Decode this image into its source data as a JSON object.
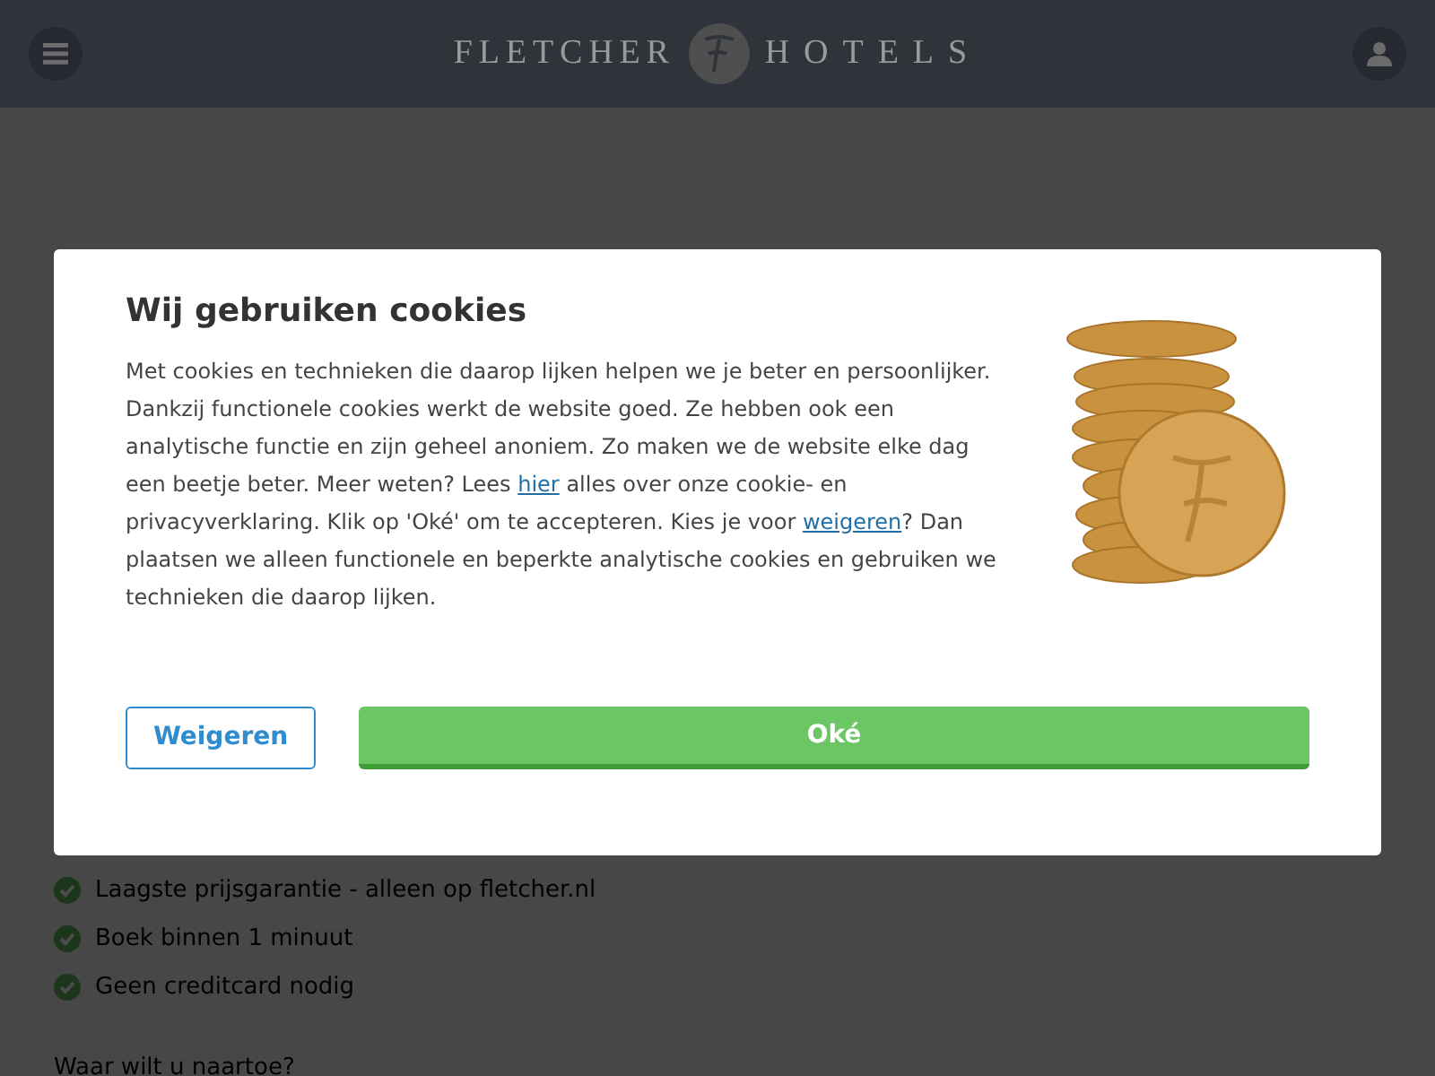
{
  "header": {
    "logo_left": "FLETCHER",
    "logo_right": "HOTELS"
  },
  "background": {
    "benefits": [
      "Laagste prijsgarantie - alleen op fletcher.nl",
      "Boek binnen 1 minuut",
      "Geen creditcard nodig"
    ],
    "question": "Waar wilt u naartoe?"
  },
  "cookie_dialog": {
    "title": "Wij gebruiken cookies",
    "body": [
      {
        "kind": "text",
        "text": "Met cookies en technieken die daarop lijken helpen we je beter en persoonlijker. Dankzij functionele cookies werkt de website goed. Ze hebben ook een analytische functie en zijn geheel anoniem. Zo maken we de website elke dag een beetje beter. Meer weten? Lees "
      },
      {
        "kind": "link",
        "text": "hier"
      },
      {
        "kind": "text",
        "text": " alles over onze cookie- en privacyverklaring. Klik op 'Oké' om te accepteren. Kies je voor "
      },
      {
        "kind": "link",
        "text": "weigeren"
      },
      {
        "kind": "text",
        "text": "? Dan plaatsen we alleen functionele en beperkte analytische cookies en gebruiken we technieken die daarop lijken."
      }
    ],
    "buttons": [
      {
        "kind": "outline",
        "label": "Weigeren"
      },
      {
        "kind": "primary",
        "label": "Oké"
      }
    ]
  }
}
